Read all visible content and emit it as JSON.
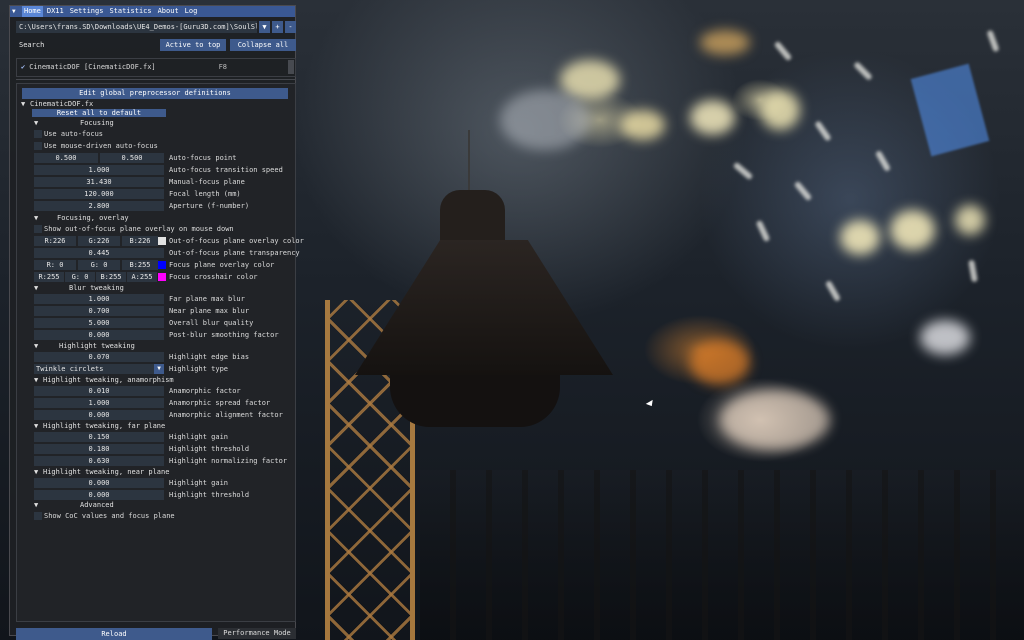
{
  "menu": {
    "items": [
      "Home",
      "DX11",
      "Settings",
      "Statistics",
      "About",
      "Log"
    ],
    "active": "Home"
  },
  "path": {
    "value": "C:\\Users\\frans.SD\\Downloads\\UE4_Demos-[Guru3D.com]\\SoulSlum\\Engi",
    "dropdown_icon": "▼",
    "add_icon": "+",
    "remove_icon": "-"
  },
  "search": {
    "placeholder": "Search",
    "active_to_top": "Active to top",
    "collapse_all": "Collapse all"
  },
  "effect": {
    "checked": true,
    "check_icon": "✔",
    "name": "CinematicDOF [CinematicDOF.fx]",
    "key": "F8"
  },
  "panel": {
    "edit_defs": "Edit global preprocessor definitions",
    "file": "CinematicDOF.fx",
    "reset": "Reset all to default",
    "focusing": {
      "title": "Focusing",
      "auto_focus": "Use auto-focus",
      "mouse_focus": "Use mouse-driven auto-focus",
      "afp_x": "0.500",
      "afp_y": "0.500",
      "afp_label": "Auto-focus point",
      "transition": "1.000",
      "transition_label": "Auto-focus transition speed",
      "manual": "31.430",
      "manual_label": "Manual-focus plane",
      "focal": "120.000",
      "focal_label": "Focal length (mm)",
      "aperture": "2.800",
      "aperture_label": "Aperture (f-number)"
    },
    "overlay": {
      "title": "Focusing, overlay",
      "show_label": "Show out-of-focus plane overlay on mouse down",
      "oof_r": "R:226",
      "oof_g": "G:226",
      "oof_b": "B:226",
      "oof_color": "#e2e2e2",
      "oof_label": "Out-of-focus plane overlay color",
      "transp": "0.445",
      "transp_label": "Out-of-focus plane transparency",
      "fp_r": "R:  0",
      "fp_g": "G:  0",
      "fp_b": "B:255",
      "fp_color": "#0000ff",
      "fp_label": "Focus plane overlay color",
      "ch_r": "R:255",
      "ch_g": "G:  0",
      "ch_b": "B:255",
      "ch_a": "A:255",
      "ch_color": "#ff00ff",
      "ch_label": "Focus crosshair color"
    },
    "blur": {
      "title": "Blur tweaking",
      "far": "1.000",
      "far_label": "Far plane max blur",
      "near": "0.700",
      "near_label": "Near plane max blur",
      "quality": "5.000",
      "quality_label": "Overall blur quality",
      "smooth": "0.000",
      "smooth_label": "Post-blur smoothing factor"
    },
    "highlight": {
      "title": "Highlight tweaking",
      "edge": "0.070",
      "edge_label": "Highlight edge bias",
      "type": "Twinkle circlets",
      "type_label": "Highlight type"
    },
    "anamorph": {
      "title": "Highlight tweaking, anamorphism",
      "factor": "0.010",
      "factor_label": "Anamorphic factor",
      "spread": "1.000",
      "spread_label": "Anamorphic spread factor",
      "align": "0.000",
      "align_label": "Anamorphic alignment factor"
    },
    "far": {
      "title": "Highlight tweaking, far plane",
      "gain": "0.150",
      "gain_label": "Highlight gain",
      "thresh": "0.180",
      "thresh_label": "Highlight threshold",
      "norm": "0.630",
      "norm_label": "Highlight normalizing factor"
    },
    "near": {
      "title": "Highlight tweaking, near plane",
      "gain": "0.000",
      "gain_label": "Highlight gain",
      "thresh": "0.000",
      "thresh_label": "Highlight threshold"
    },
    "advanced": {
      "title": "Advanced",
      "coc_label": "Show CoC values and focus plane"
    }
  },
  "footer": {
    "reload": "Reload",
    "perf": "Performance Mode"
  },
  "icons": {
    "open": "▼",
    "combo_arrow": "▼",
    "menu_tri": "▼"
  }
}
